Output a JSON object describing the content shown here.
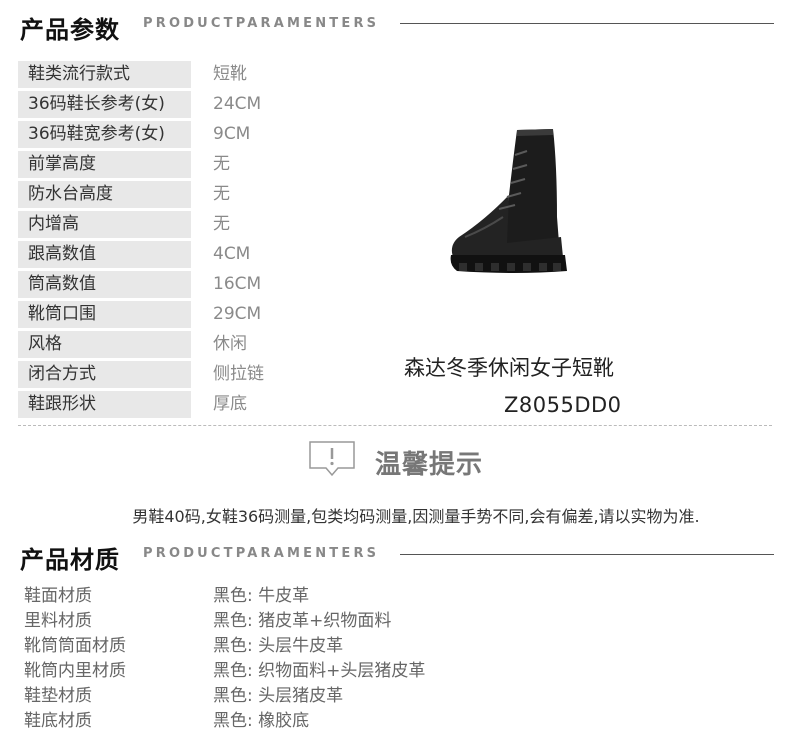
{
  "params_section": {
    "title": "产品参数",
    "subtitle": "PRODUCTPARAMENTERS"
  },
  "params": [
    {
      "label": "鞋类流行款式",
      "value": "短靴"
    },
    {
      "label": "36码鞋长参考(女)",
      "value": "24CM"
    },
    {
      "label": "36码鞋宽参考(女)",
      "value": "9CM"
    },
    {
      "label": "前掌高度",
      "value": "无"
    },
    {
      "label": "防水台高度",
      "value": "无"
    },
    {
      "label": "内增高",
      "value": "无"
    },
    {
      "label": "跟高数值",
      "value": "4CM"
    },
    {
      "label": "筒高数值",
      "value": "16CM"
    },
    {
      "label": "靴筒口围",
      "value": "29CM"
    },
    {
      "label": "风格",
      "value": "休闲"
    },
    {
      "label": "闭合方式",
      "value": "侧拉链"
    },
    {
      "label": "鞋跟形状",
      "value": "厚底"
    }
  ],
  "product": {
    "name": "森达冬季休闲女子短靴",
    "code": "Z8055DD0"
  },
  "tip": {
    "title": "温馨提示",
    "text": "男鞋40码,女鞋36码测量,包类均码测量,因测量手势不同,会有偏差,请以实物为准."
  },
  "material_section": {
    "title": "产品材质",
    "subtitle": "PRODUCTPARAMENTERS"
  },
  "materials": [
    {
      "label": "鞋面材质",
      "value": "黑色: 牛皮革"
    },
    {
      "label": "里料材质",
      "value": "黑色: 猪皮革+织物面料"
    },
    {
      "label": "靴筒筒面材质",
      "value": "黑色: 头层牛皮革"
    },
    {
      "label": "靴筒内里材质",
      "value": "黑色: 织物面料+头层猪皮革"
    },
    {
      "label": "鞋垫材质",
      "value": "黑色: 头层猪皮革"
    },
    {
      "label": "鞋底材质",
      "value": "黑色: 橡胶底"
    }
  ],
  "colors": {
    "label_bg": "#e8e8e8",
    "value_text": "#8a8a8a",
    "rule": "#555555"
  },
  "icons": {
    "tip": "speech-bubble-exclamation-icon",
    "product": "black-lace-up-boot-image"
  }
}
